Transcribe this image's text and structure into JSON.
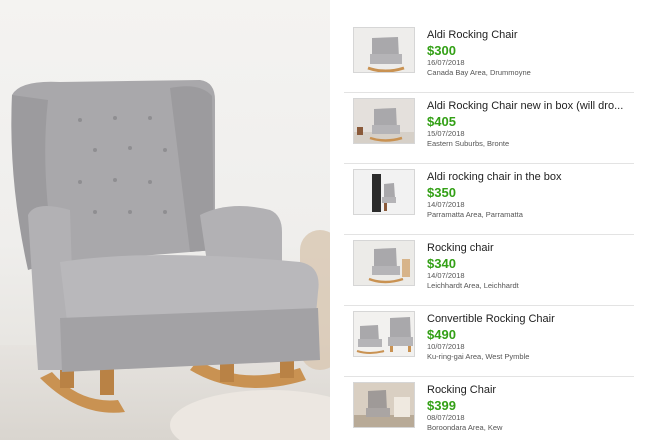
{
  "listings": [
    {
      "title": "Aldi Rocking Chair",
      "price": "$300",
      "date": "16/07/2018",
      "location": "Canada Bay Area, Drummoyne",
      "thumb_icon": "grey-rocking-chair-photo"
    },
    {
      "title": "Aldi Rocking Chair new in box (will dro...",
      "price": "$405",
      "date": "15/07/2018",
      "location": "Eastern Suburbs, Bronte",
      "thumb_icon": "rocking-chair-room-photo"
    },
    {
      "title": "Aldi rocking chair in the box",
      "price": "$350",
      "date": "14/07/2018",
      "location": "Parramatta Area, Parramatta",
      "thumb_icon": "boxed-chair-photo"
    },
    {
      "title": "Rocking chair",
      "price": "$340",
      "date": "14/07/2018",
      "location": "Leichhardt Area, Leichhardt",
      "thumb_icon": "rocking-chair-photo"
    },
    {
      "title": "Convertible Rocking Chair",
      "price": "$490",
      "date": "10/07/2018",
      "location": "Ku-ring-gai Area, West Pymble",
      "thumb_icon": "two-chairs-photo"
    },
    {
      "title": "Rocking Chair",
      "price": "$399",
      "date": "08/07/2018",
      "location": "Boroondara Area, Kew",
      "thumb_icon": "chair-in-room-photo"
    }
  ],
  "colors": {
    "price": "#33a016",
    "chair": "#a9a8ab",
    "wood": "#c99252",
    "divider": "#e3e3e3"
  }
}
